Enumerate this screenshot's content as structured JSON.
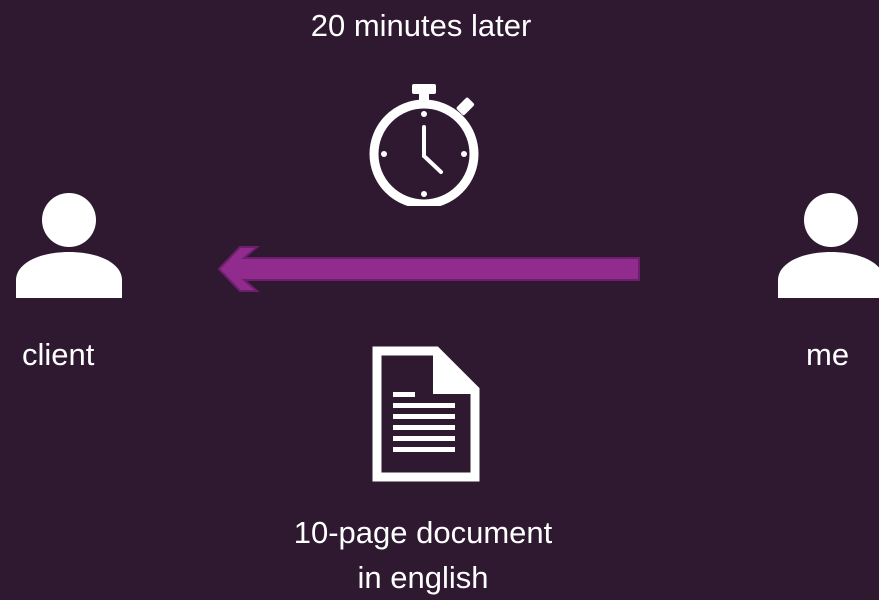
{
  "header": {
    "title": "20 minutes later"
  },
  "actors": {
    "client": {
      "label": "client",
      "icon": "person-icon"
    },
    "me": {
      "label": "me",
      "icon": "person-icon"
    }
  },
  "arrow": {
    "direction": "right-to-left",
    "color": "#922b8e"
  },
  "timer": {
    "icon": "stopwatch-icon"
  },
  "document": {
    "icon": "document-icon",
    "caption_line1": "10-page document",
    "caption_line2": "in english"
  },
  "colors": {
    "background": "#2e1931",
    "foreground": "#ffffff",
    "accent": "#922b8e"
  }
}
